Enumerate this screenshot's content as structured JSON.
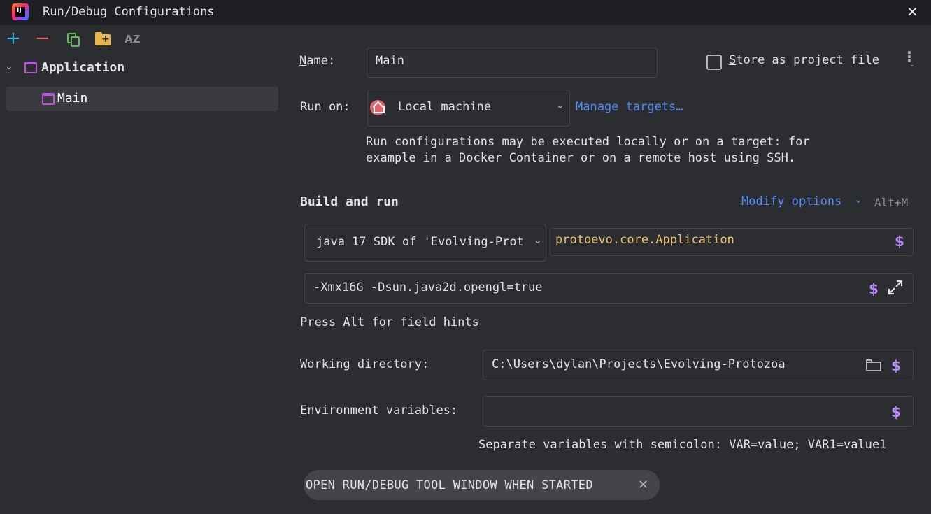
{
  "window": {
    "title": "Run/Debug Configurations",
    "close_glyph": "✕",
    "logo_text": "IJ"
  },
  "toolbar": {
    "add_glyph": "+",
    "remove_glyph": "−",
    "folder_plus_glyph": "+",
    "sort_glyph": "AZ"
  },
  "tree": {
    "chevron": "⌄",
    "group_label": "Application",
    "items": [
      {
        "label": "Main",
        "selected": true
      }
    ]
  },
  "form": {
    "name_label_first": "N",
    "name_label_rest": "ame:",
    "name_value": "Main",
    "store_label_first": "S",
    "store_label_rest": "tore as project file",
    "store_checked": false,
    "run_on_label": "Run on:",
    "run_on_value": "Local machine",
    "manage_targets": "Manage targets…",
    "run_on_hint_line1": "Run configurations may be executed locally or on a target: for",
    "run_on_hint_line2": "example in a Docker Container or on a remote host using SSH.",
    "build_and_run": "Build and run",
    "modify_options_first": "M",
    "modify_options_rest": "odify options",
    "modify_options_shortcut": "Alt+M",
    "sdk_value": "java 17 SDK of 'Evolving-Prot",
    "main_class": "protoevo.core.Application",
    "vm_options": "-Xmx16G -Dsun.java2d.opengl=true",
    "field_hints": "Press Alt for field hints",
    "working_dir_label_first": "W",
    "working_dir_label_rest": "orking directory:",
    "working_dir_value": "C:\\Users\\dylan\\Projects\\Evolving-Protozoa",
    "env_label_first": "E",
    "env_label_rest": "nvironment variables:",
    "env_value": "",
    "env_hint": "Separate variables with semicolon: VAR=value; VAR1=value1",
    "dollar": "$",
    "chip_label": "OPEN RUN/DEBUG TOOL WINDOW WHEN STARTED",
    "chip_close": "✕"
  },
  "colors": {
    "background": "#2b2d30",
    "title_bg": "#1e1f22",
    "accent_link": "#548af7",
    "macro_purple": "#b889f4",
    "class_orange": "#e8bf6a",
    "config_icon": "#b657d6",
    "add_icon": "#3fb4e0",
    "remove_icon": "#e5636b",
    "copy_icon": "#5fb85a",
    "folder_icon": "#e8b64a"
  }
}
